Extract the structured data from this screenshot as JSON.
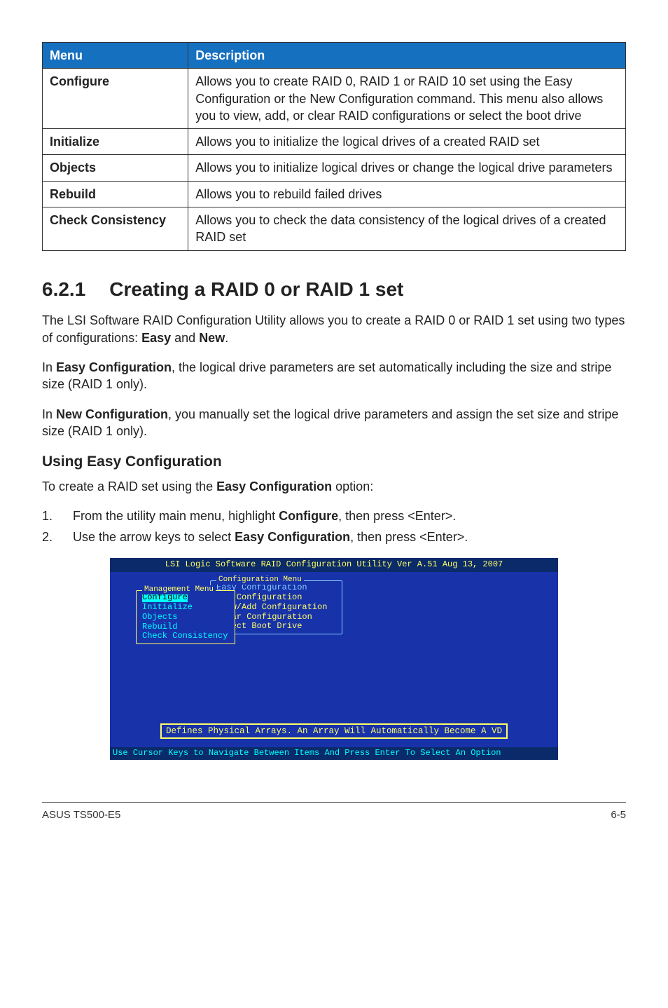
{
  "table": {
    "headers": [
      "Menu",
      "Description"
    ],
    "rows": [
      {
        "menu": "Configure",
        "desc": "Allows you to create RAID 0, RAID 1 or RAID 10 set using the Easy Configuration or the New Configuration command. This menu also allows you to view, add, or clear RAID configurations or select the boot drive"
      },
      {
        "menu": "Initialize",
        "desc": "Allows you to initialize the logical drives of a created RAID set"
      },
      {
        "menu": "Objects",
        "desc": "Allows you to initialize logical drives or change the logical drive parameters"
      },
      {
        "menu": "Rebuild",
        "desc": "Allows you to rebuild failed drives"
      },
      {
        "menu": "Check Consistency",
        "desc": "Allows you to check the data consistency of the logical drives of a created RAID set"
      }
    ]
  },
  "section": {
    "number": "6.2.1",
    "title": "Creating a RAID 0 or RAID 1 set"
  },
  "para1_a": "The LSI Software RAID Configuration Utility allows you to create a RAID 0 or RAID 1 set using two types of configurations: ",
  "para1_easy": "Easy",
  "para1_and": " and ",
  "para1_new": "New",
  "para1_end": ".",
  "para2_a": "In ",
  "para2_b": "Easy Configuration",
  "para2_c": ", the logical drive parameters are set automatically including the size and stripe size (RAID 1 only).",
  "para3_a": "In ",
  "para3_b": "New Configuration",
  "para3_c": ", you manually set the logical drive parameters and assign the set size and stripe size (RAID 1 only).",
  "subhead": "Using Easy Configuration",
  "intro_a": "To create a RAID set using the ",
  "intro_b": "Easy Configuration",
  "intro_c": " option:",
  "steps": [
    {
      "n": "1.",
      "a": "From the utility main menu, highlight ",
      "b": "Configure",
      "c": ", then press <Enter>."
    },
    {
      "n": "2.",
      "a": "Use the arrow keys to select ",
      "b": "Easy Configuration",
      "c": ", then press <Enter>."
    }
  ],
  "bios": {
    "title": "LSI Logic Software RAID Configuration Utility Ver A.51 Aug 13, 2007",
    "mgmt_legend": "Management Menu",
    "mgmt_items": [
      "Configure",
      "Initialize",
      "Objects",
      "Rebuild",
      "Check Consistency"
    ],
    "cfg_legend": "Configuration Menu",
    "cfg_items": [
      "Easy Configuration",
      "New Configuration",
      "View/Add Configuration",
      "Clear Configuration",
      "Select Boot Drive"
    ],
    "hint": "Defines Physical Arrays. An Array Will Automatically Become A VD",
    "footer": "Use Cursor Keys to Navigate Between Items And Press Enter To Select An Option"
  },
  "page_footer": {
    "left": "ASUS TS500-E5",
    "right": "6-5"
  }
}
